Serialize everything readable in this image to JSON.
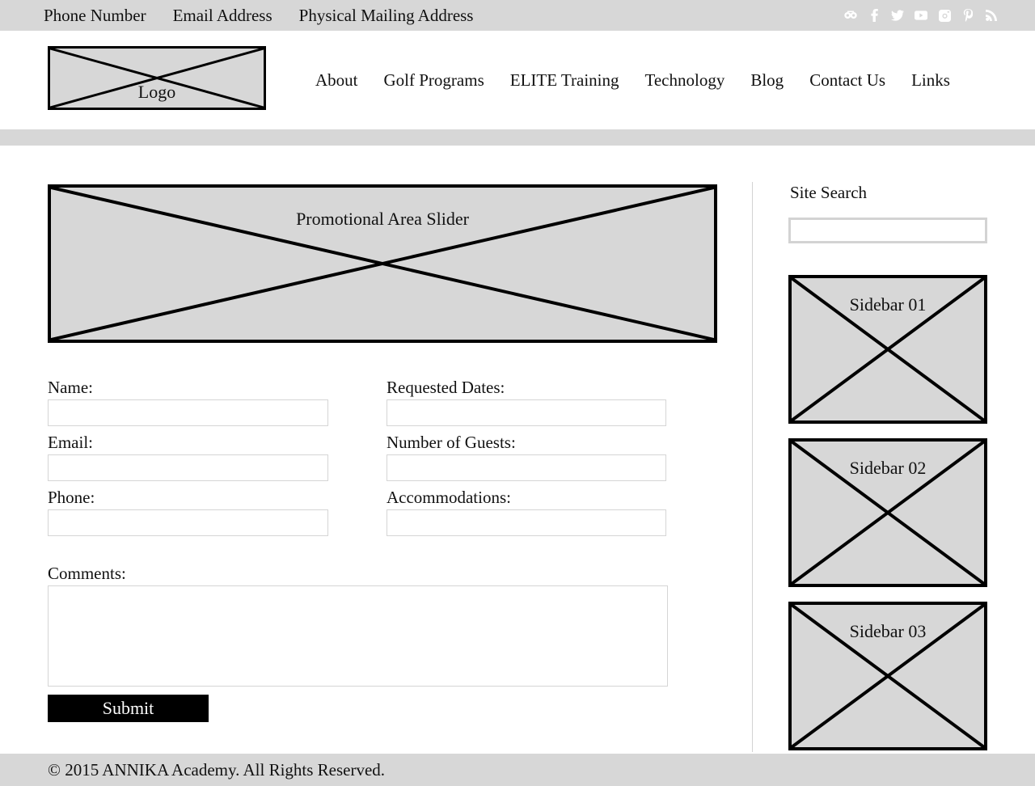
{
  "topbar": {
    "links": [
      {
        "label": "Phone Number"
      },
      {
        "label": "Email Address"
      },
      {
        "label": "Physical Mailing Address"
      }
    ],
    "social": [
      {
        "name": "tripadvisor-icon",
        "label": "TripAdvisor"
      },
      {
        "name": "facebook-icon",
        "label": "Facebook"
      },
      {
        "name": "twitter-icon",
        "label": "Twitter"
      },
      {
        "name": "youtube-icon",
        "label": "YouTube"
      },
      {
        "name": "instagram-icon",
        "label": "Instagram"
      },
      {
        "name": "pinterest-icon",
        "label": "Pinterest"
      },
      {
        "name": "rss-icon",
        "label": "RSS"
      }
    ],
    "background": "#d7d7d7",
    "icon_color": "#ffffff"
  },
  "header": {
    "logo_placeholder": "Logo",
    "nav": [
      {
        "label": "About"
      },
      {
        "label": "Golf Programs"
      },
      {
        "label": "ELITE Training"
      },
      {
        "label": "Technology"
      },
      {
        "label": "Blog"
      },
      {
        "label": "Contact Us"
      },
      {
        "label": "Links"
      }
    ]
  },
  "main": {
    "slider_placeholder": "Promotional Area Slider",
    "form": {
      "left_fields": [
        {
          "label": "Name:",
          "value": "",
          "placeholder": ""
        },
        {
          "label": "Email:",
          "value": "",
          "placeholder": ""
        },
        {
          "label": "Phone:",
          "value": "",
          "placeholder": ""
        }
      ],
      "right_fields": [
        {
          "label": "Requested Dates:",
          "value": "",
          "placeholder": ""
        },
        {
          "label": "Number of Guests:",
          "value": "",
          "placeholder": ""
        },
        {
          "label": "Accommodations:",
          "value": "",
          "placeholder": ""
        }
      ],
      "comments_label": "Comments:",
      "comments_value": "",
      "comments_placeholder": "",
      "submit_label": "Submit",
      "submit_background": "#000000",
      "submit_text_color": "#ffffff"
    }
  },
  "sidebar": {
    "search_title": "Site Search",
    "search_value": "",
    "search_placeholder": "",
    "boxes": [
      {
        "label": "Sidebar 01"
      },
      {
        "label": "Sidebar 02"
      },
      {
        "label": "Sidebar 03"
      }
    ]
  },
  "footer": {
    "copyright": "© 2015 ANNIKA Academy. All Rights Reserved.",
    "background": "#d7d7d7"
  },
  "theme": {
    "gray": "#d7d7d7",
    "placeholder_fill": "#d7d7d7",
    "placeholder_border": "#000000",
    "input_border": "#d5d5d5",
    "page_background": "#ffffff"
  }
}
